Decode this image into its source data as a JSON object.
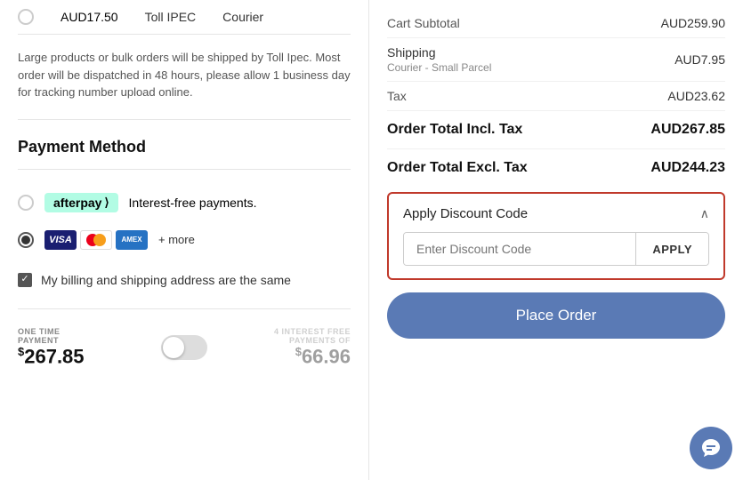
{
  "left": {
    "shipping": {
      "price": "AUD17.50",
      "carrier": "Toll IPEC",
      "method": "Courier"
    },
    "shipping_note": "Large products or bulk orders will be shipped by Toll Ipec. Most order will be dispatched in 48 hours, please allow 1 business day for tracking number upload online.",
    "payment_section_title": "Payment Method",
    "payment_options": [
      {
        "id": "afterpay",
        "label": "Interest-free payments.",
        "selected": false
      },
      {
        "id": "card",
        "label": "+ more",
        "selected": true
      }
    ],
    "billing_checkbox_label": "My billing and shipping address are the same",
    "one_time": {
      "label_line1": "ONE TIME",
      "label_line2": "PAYMENT",
      "amount_symbol": "$",
      "amount": "267.85"
    },
    "installment": {
      "label_line1": "4 INTEREST FREE",
      "label_line2": "PAYMENTS OF",
      "amount_symbol": "$",
      "amount": "66.96"
    }
  },
  "right": {
    "cart_subtotal_label": "Cart Subtotal",
    "cart_subtotal_amount": "AUD259.90",
    "shipping_label": "Shipping",
    "shipping_amount": "AUD7.95",
    "shipping_sub_label": "Courier - Small Parcel",
    "tax_label": "Tax",
    "tax_amount": "AUD23.62",
    "order_total_incl_label": "Order Total Incl. Tax",
    "order_total_incl_amount": "AUD267.85",
    "order_total_excl_label": "Order Total Excl. Tax",
    "order_total_excl_amount": "AUD244.23",
    "discount": {
      "section_title": "Apply Discount Code",
      "chevron": "∧",
      "input_placeholder": "Enter Discount Code",
      "apply_button_label": "APPLY"
    },
    "place_order_button": "Place Order"
  }
}
